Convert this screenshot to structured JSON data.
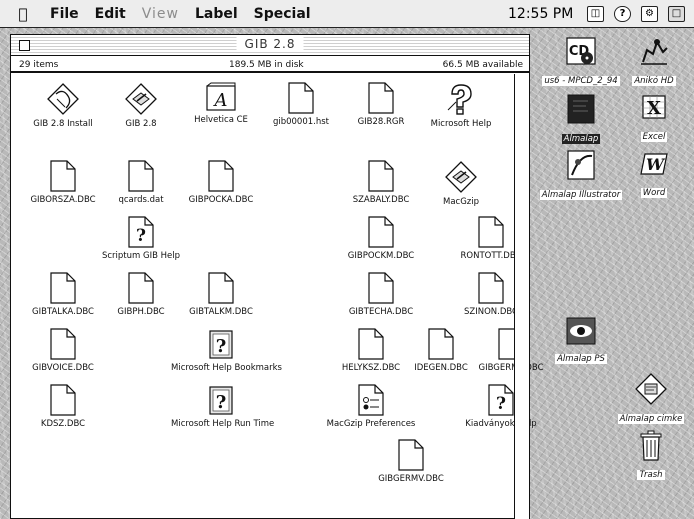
{
  "menubar": {
    "apple": "",
    "items": [
      "File",
      "Edit",
      "View",
      "Label",
      "Special"
    ],
    "clock": "12:55 PM"
  },
  "window": {
    "title": "GIB 2.8",
    "items_count": "29 items",
    "disk": "189.5 MB in disk",
    "available": "66.5 MB available",
    "files": [
      {
        "label": "GIB 2.8 Install",
        "icon": "installer-icon"
      },
      {
        "label": "GIB 2.8",
        "icon": "app-icon"
      },
      {
        "label": "Helvetica CE",
        "icon": "font-icon"
      },
      {
        "label": "gib00001.hst",
        "icon": "document-icon"
      },
      {
        "label": "GIB28.RGR",
        "icon": "document-icon"
      },
      {
        "label": "Microsoft Help",
        "icon": "help-icon"
      },
      {
        "label": "GIBORSZA.DBC",
        "icon": "document-icon"
      },
      {
        "label": "qcards.dat",
        "icon": "document-icon"
      },
      {
        "label": "GIBPOCKA.DBC",
        "icon": "document-icon"
      },
      {
        "label": "SZABALY.DBC",
        "icon": "document-icon"
      },
      {
        "label": "MacGzip",
        "icon": "app-icon"
      },
      {
        "label": "Scriptum GIB Help",
        "icon": "help-doc-icon"
      },
      {
        "label": "GIBPOCKM.DBC",
        "icon": "document-icon"
      },
      {
        "label": "RONTOTT.DBC",
        "icon": "document-icon"
      },
      {
        "label": "GIBTALKA.DBC",
        "icon": "document-icon"
      },
      {
        "label": "GIBPH.DBC",
        "icon": "document-icon"
      },
      {
        "label": "GIBTALKM.DBC",
        "icon": "document-icon"
      },
      {
        "label": "GIBTECHA.DBC",
        "icon": "document-icon"
      },
      {
        "label": "SZINON.DBC",
        "icon": "document-icon"
      },
      {
        "label": "GIBVOICE.DBC",
        "icon": "document-icon"
      },
      {
        "label": "Microsoft Help Bookmarks",
        "icon": "help-app-icon"
      },
      {
        "label": "HELYKSZ.DBC",
        "icon": "document-icon"
      },
      {
        "label": "IDEGEN.DBC",
        "icon": "document-icon"
      },
      {
        "label": "GIBGERMT.DBC",
        "icon": "document-icon"
      },
      {
        "label": "KDSZ.DBC",
        "icon": "document-icon"
      },
      {
        "label": "Microsoft Help Run Time",
        "icon": "help-app-icon"
      },
      {
        "label": "MacGzip Preferences",
        "icon": "prefs-icon"
      },
      {
        "label": "Kiadványok Help",
        "icon": "help-doc-icon"
      },
      {
        "label": "GIBGERMV.DBC",
        "icon": "document-icon"
      }
    ]
  },
  "desktop": [
    {
      "label": "us6 - MPCD_2_94",
      "icon": "cd-icon"
    },
    {
      "label": "Anikó HD",
      "icon": "harddisk-icon"
    },
    {
      "label": "Almalap",
      "icon": "folder-icon"
    },
    {
      "label": "Excel",
      "icon": "excel-icon"
    },
    {
      "label": "Almalap Illustrator",
      "icon": "illustrator-icon"
    },
    {
      "label": "Word",
      "icon": "word-icon"
    },
    {
      "label": "Almalap PS",
      "icon": "eye-icon"
    },
    {
      "label": "Almalap cimke",
      "icon": "label-app-icon"
    },
    {
      "label": "Trash",
      "icon": "trash-icon"
    }
  ]
}
